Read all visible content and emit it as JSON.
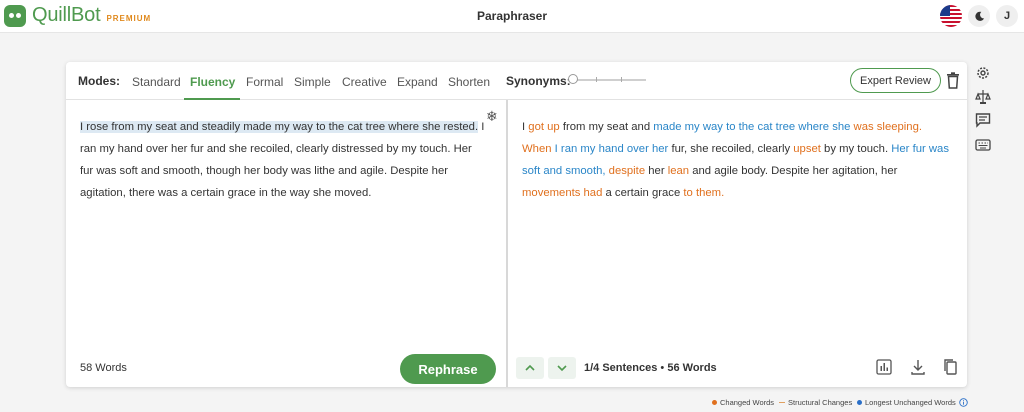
{
  "app": {
    "logo_name": "QuillBot",
    "logo_badge": "PREMIUM",
    "title": "Paraphraser",
    "user_initial": "J"
  },
  "colors": {
    "brand": "#4f9a4f",
    "changed": "#e0701e",
    "unchanged": "#2a86c8",
    "highlight": "#dde9f3"
  },
  "modes": {
    "label": "Modes:",
    "items": [
      "Standard",
      "Fluency",
      "Formal",
      "Simple",
      "Creative",
      "Expand",
      "Shorten"
    ],
    "active": "Fluency"
  },
  "synonyms": {
    "label": "Synonyms:"
  },
  "toolbar": {
    "expert_review_label": "Expert Review"
  },
  "input": {
    "highlighted_text": "I rose from my seat and steadily made my way to the cat tree where she rested.",
    "rest_text": " I ran my hand over her fur and she recoiled, clearly distressed by my touch. Her fur was soft and smooth, though her body was lithe and agile. Despite her agitation, there was a certain grace in the way she moved.",
    "word_count": "58 Words",
    "rephrase_label": "Rephrase"
  },
  "output": {
    "segments": [
      {
        "t": "I ",
        "k": "n"
      },
      {
        "t": "got up",
        "k": "c"
      },
      {
        "t": " from my seat and ",
        "k": "n"
      },
      {
        "t": "made my way to the cat tree where she",
        "k": "u"
      },
      {
        "t": " was sleeping.",
        "k": "c"
      },
      {
        "t": " When",
        "k": "c"
      },
      {
        "t": " I ran my hand over her",
        "k": "u"
      },
      {
        "t": " fur, she recoiled, clearly ",
        "k": "n"
      },
      {
        "t": "upset",
        "k": "c"
      },
      {
        "t": " by my touch. ",
        "k": "n"
      },
      {
        "t": "Her fur was soft and smooth,",
        "k": "u"
      },
      {
        "t": " despite",
        "k": "c"
      },
      {
        "t": " her ",
        "k": "n"
      },
      {
        "t": "lean",
        "k": "c"
      },
      {
        "t": " and agile body. Despite her agitation, her ",
        "k": "n"
      },
      {
        "t": "movements had",
        "k": "c"
      },
      {
        "t": " a certain grace ",
        "k": "n"
      },
      {
        "t": "to them.",
        "k": "c"
      }
    ],
    "sentence_counter": "1/4 Sentences",
    "word_count": "56 Words"
  },
  "legend": {
    "changed": "Changed Words",
    "structural": "Structural Changes",
    "longest": "Longest Unchanged Words"
  },
  "icons": {
    "settings": "gear-icon",
    "compare": "compare-icon",
    "feedback": "feedback-icon",
    "keyboard": "keyboard-icon",
    "freeze": "snowflake-icon",
    "delete": "trash-icon",
    "stats": "stats-icon",
    "export": "download-icon",
    "copy": "copy-icon",
    "theme": "moon-icon",
    "language": "us-flag-icon",
    "info": "info-icon"
  }
}
